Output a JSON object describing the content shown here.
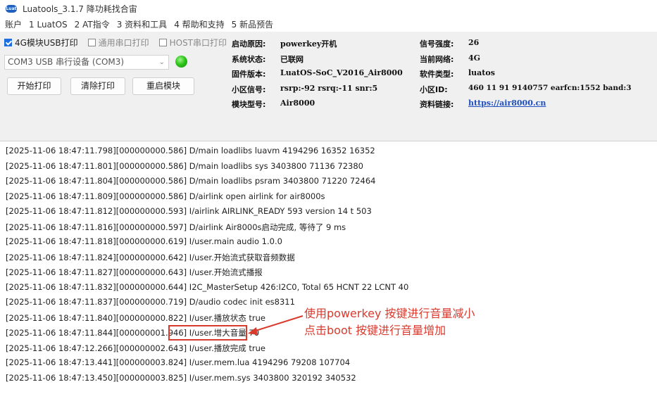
{
  "titlebar": {
    "title": "Luatools_3.1.7 降功耗找合宙",
    "logo_text": "Luat"
  },
  "menu": [
    "账户",
    "1 LuatOS",
    "2 AT指令",
    "3 资料和工具",
    "4 帮助和支持",
    "5 新品预告"
  ],
  "options": [
    {
      "label": "4G模块USB打印",
      "checked": true,
      "enabled": true
    },
    {
      "label": "通用串口打印",
      "checked": false,
      "enabled": false
    },
    {
      "label": "HOST串口打印",
      "checked": false,
      "enabled": false
    }
  ],
  "port_select": {
    "value": "COM3 USB 串行设备 (COM3)"
  },
  "status_led": {
    "color": "#2fc61a"
  },
  "buttons": {
    "start": "开始打印",
    "clear": "清除打印",
    "restart": "重启模块"
  },
  "info_left": [
    {
      "label": "启动原因:",
      "value": "powerkey开机"
    },
    {
      "label": "系统状态:",
      "value": "已联网"
    },
    {
      "label": "固件版本:",
      "value": "LuatOS-SoC_V2016_Air8000"
    },
    {
      "label": "小区信号:",
      "value": "rsrp:-92 rsrq:-11 snr:5"
    },
    {
      "label": "模块型号:",
      "value": "Air8000"
    }
  ],
  "info_right": [
    {
      "label": "信号强度:",
      "value": "26"
    },
    {
      "label": "当前网络:",
      "value": "4G"
    },
    {
      "label": "软件类型:",
      "value": "luatos"
    },
    {
      "label": "小区ID:",
      "value": "460 11 91 9140757 earfcn:1552 band:3"
    },
    {
      "label": "资料链接:",
      "value": "https://air8000.cn"
    }
  ],
  "log_lines": [
    "[2025-11-06 18:47:11.798][000000000.586] D/main loadlibs luavm 4194296 16352 16352",
    "[2025-11-06 18:47:11.801][000000000.586] D/main loadlibs sys   3403800 71136 72380",
    "[2025-11-06 18:47:11.804][000000000.586] D/main loadlibs psram 3403800 71220 72464",
    "[2025-11-06 18:47:11.809][000000000.586] D/airlink open airlink for air8000s",
    "[2025-11-06 18:47:11.812][000000000.593] I/airlink AIRLINK_READY 593 version 14 t 503",
    "[2025-11-06 18:47:11.816][000000000.597] D/airlink Air8000s启动完成, 等待了 9 ms",
    "[2025-11-06 18:47:11.818][000000000.619] I/user.main audio 1.0.0",
    "[2025-11-06 18:47:11.824][000000000.642] I/user.开始流式获取音频数据",
    "[2025-11-06 18:47:11.827][000000000.643] I/user.开始流式播报",
    "[2025-11-06 18:47:11.832][000000000.644] I2C_MasterSetup 426:I2C0, Total 65 HCNT 22 LCNT 40",
    "[2025-11-06 18:47:11.837][000000000.719] D/audio codec init es8311",
    "[2025-11-06 18:47:11.840][000000000.822] I/user.播放状态 true",
    "[2025-11-06 18:47:11.844][000000001.946] I/user.增大音量 70",
    "[2025-11-06 18:47:12.266][000000002.643] I/user.播放完成 true",
    "[2025-11-06 18:47:13.441][000000003.824] I/user.mem.lua 4194296 79208 107704",
    "[2025-11-06 18:47:13.450][000000003.825] I/user.mem.sys 3403800 320192 340532"
  ],
  "annotation": {
    "line1": "使用powerkey 按键进行音量减小",
    "line2": "点击boot 按键进行音量增加",
    "color": "#d93a2e"
  }
}
